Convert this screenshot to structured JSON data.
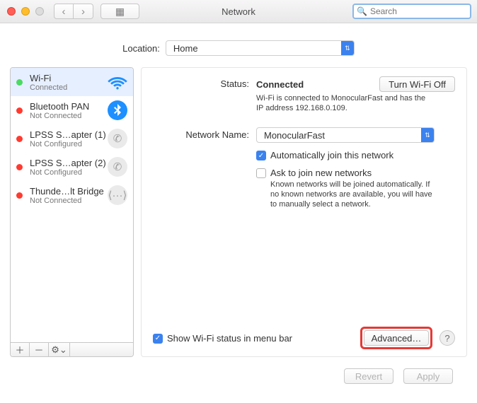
{
  "title": "Network",
  "search": {
    "placeholder": "Search"
  },
  "location": {
    "label": "Location:",
    "value": "Home"
  },
  "sidebar": {
    "items": [
      {
        "name": "Wi-Fi",
        "sub": "Connected",
        "status": "green",
        "icon": "wifi"
      },
      {
        "name": "Bluetooth PAN",
        "sub": "Not Connected",
        "status": "red",
        "icon": "bluetooth"
      },
      {
        "name": "LPSS S…apter (1)",
        "sub": "Not Configured",
        "status": "red",
        "icon": "phone"
      },
      {
        "name": "LPSS S…apter (2)",
        "sub": "Not Configured",
        "status": "red",
        "icon": "phone"
      },
      {
        "name": "Thunde…lt Bridge",
        "sub": "Not Connected",
        "status": "red",
        "icon": "bridge"
      }
    ]
  },
  "main": {
    "status_label": "Status:",
    "status_value": "Connected",
    "turn_off_label": "Turn Wi-Fi Off",
    "status_desc": "Wi-Fi is connected to MonocularFast and has the IP address 192.168.0.109.",
    "network_label": "Network Name:",
    "network_value": "MonocularFast",
    "auto_join": "Automatically join this network",
    "ask_join": "Ask to join new networks",
    "ask_desc": "Known networks will be joined automatically. If no known networks are available, you will have to manually select a network.",
    "show_menu": "Show Wi-Fi status in menu bar",
    "advanced": "Advanced…"
  },
  "footer": {
    "revert": "Revert",
    "apply": "Apply"
  }
}
